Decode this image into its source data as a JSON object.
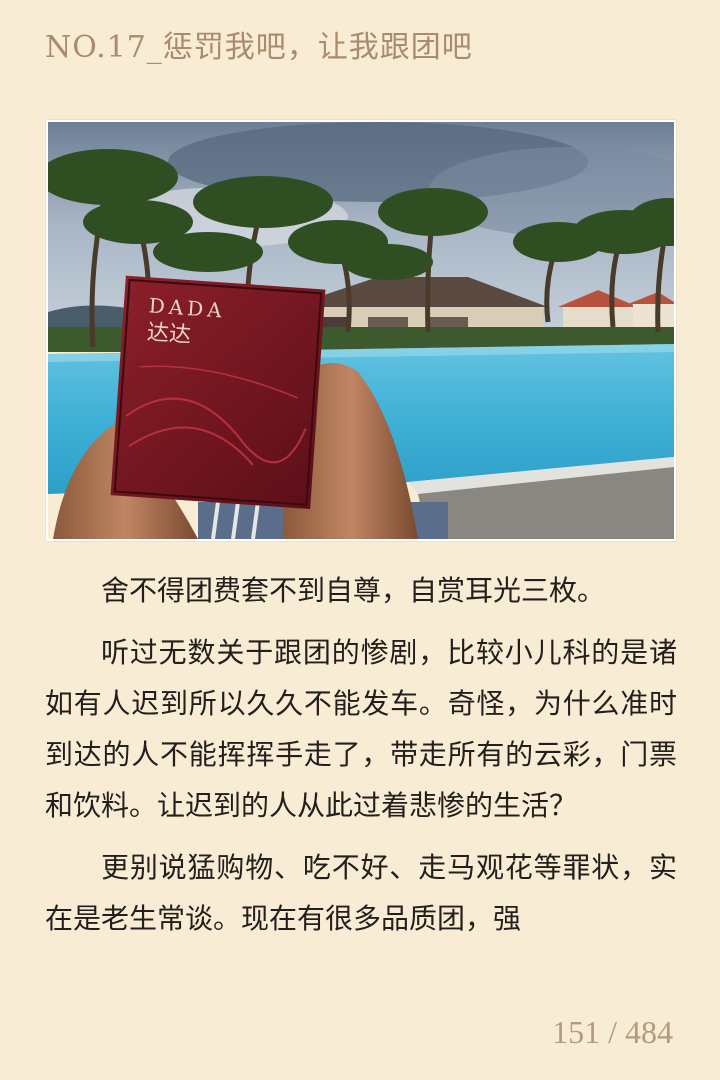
{
  "chapter": {
    "title": "NO.17_惩罚我吧，让我跟团吧"
  },
  "photo": {
    "book_title_latin": "DADA",
    "book_title_cn": "达达"
  },
  "paragraphs": [
    "舍不得团费套不到自尊，自赏耳光三枚。",
    "听过无数关于跟团的惨剧，比较小儿科的是诸如有人迟到所以久久不能发车。奇怪，为什么准时到达的人不能挥挥手走了，带走所有的云彩，门票和饮料。让迟到的人从此过着悲惨的生活？",
    "更别说猛购物、吃不好、走马观花等罪状，实在是老生常谈。现在有很多品质团，强"
  ],
  "pagination": {
    "label": "151 / 484",
    "current": 151,
    "total": 484
  }
}
